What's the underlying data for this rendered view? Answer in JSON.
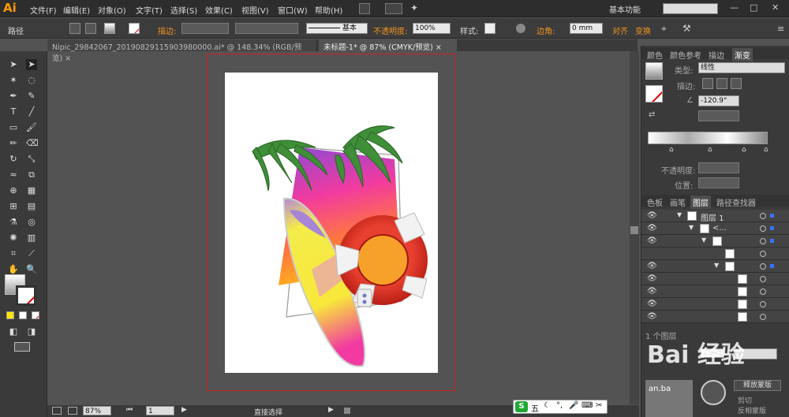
{
  "app": {
    "logo": "Ai"
  },
  "menu": [
    "文件(F)",
    "编辑(E)",
    "对象(O)",
    "文字(T)",
    "选择(S)",
    "效果(C)",
    "视图(V)",
    "窗口(W)",
    "帮助(H)"
  ],
  "workspace": "基本功能",
  "control": {
    "path_label": "路径",
    "stroke_label": "描边:",
    "stroke_style": "基本",
    "opacity_label": "不透明度:",
    "opacity_value": "100%",
    "style_label": "样式:",
    "radius_label": "边角:",
    "radius_value": "0 mm",
    "align_label": "对齐",
    "transform_label": "变换"
  },
  "tabs": [
    {
      "label": "Nipic_29842067_20190829115903980000.ai* @ 148.34% (RGB/预览)",
      "close": "×"
    },
    {
      "label": "未标题-1* @ 87% (CMYK/预览)",
      "close": "×"
    }
  ],
  "panel_top": {
    "tabs": [
      "颜色",
      "颜色参考",
      "描边",
      "渐变"
    ],
    "type_label": "类型:",
    "type_value": "线性",
    "stroke_label": "描边:",
    "angle_value": "-120.9°",
    "opacity_label": "不透明度:",
    "position_label": "位置:"
  },
  "panel_layers": {
    "tabs": [
      "色板",
      "画笔",
      "图层",
      "路径查找器"
    ],
    "layer_name": "图层 1",
    "group_name": "<...",
    "footer": "1 个图层"
  },
  "right_bottom": {
    "release_label": "释放蒙版",
    "clip_label": "剪切",
    "invert_label": "反相蒙版",
    "label": "an.ba"
  },
  "status": {
    "zoom": "87%",
    "page": "1",
    "tool": "直接选择"
  },
  "ime": {
    "label": "五"
  },
  "watermark": "Bai 经验"
}
